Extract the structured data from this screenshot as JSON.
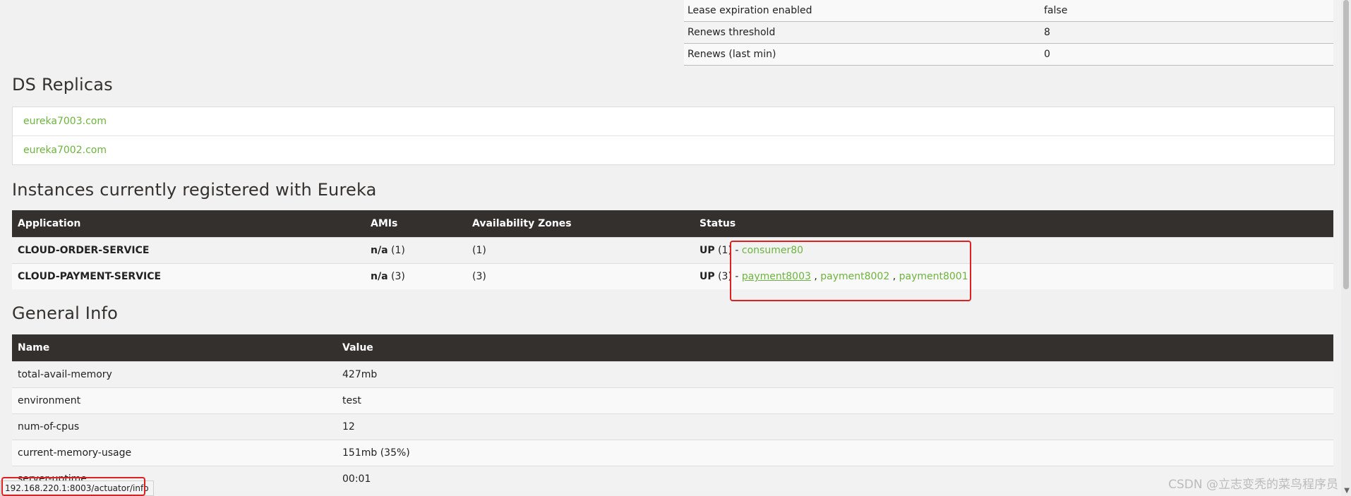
{
  "top_stats": [
    {
      "name": "Lease expiration enabled",
      "value": "false"
    },
    {
      "name": "Renews threshold",
      "value": "8"
    },
    {
      "name": "Renews (last min)",
      "value": "0"
    }
  ],
  "replicas": {
    "title": "DS Replicas",
    "items": [
      "eureka7003.com",
      "eureka7002.com"
    ]
  },
  "instances": {
    "title": "Instances currently registered with Eureka",
    "headers": [
      "Application",
      "AMIs",
      "Availability Zones",
      "Status"
    ],
    "rows": [
      {
        "app": "CLOUD-ORDER-SERVICE",
        "ami_bold": "n/a",
        "ami_count": "(1)",
        "zones": "(1)",
        "status_bold": "UP",
        "status_count": "(1) -",
        "links": [
          "consumer80"
        ]
      },
      {
        "app": "CLOUD-PAYMENT-SERVICE",
        "ami_bold": "n/a",
        "ami_count": "(3)",
        "zones": "(3)",
        "status_bold": "UP",
        "status_count": "(3) -",
        "links": [
          "payment8003",
          "payment8002",
          "payment8001"
        ]
      }
    ]
  },
  "general": {
    "title": "General Info",
    "headers": [
      "Name",
      "Value"
    ],
    "rows": [
      {
        "name": "total-avail-memory",
        "value": "427mb"
      },
      {
        "name": "environment",
        "value": "test"
      },
      {
        "name": "num-of-cpus",
        "value": "12"
      },
      {
        "name": "current-memory-usage",
        "value": "151mb (35%)"
      },
      {
        "name": "server-uptime",
        "value": "00:01"
      }
    ]
  },
  "statusbar": {
    "url": "192.168.220.1:8003/actuator/info"
  },
  "watermark": "CSDN @立志变秃的菜鸟程序员",
  "colors": {
    "header_bg": "#34302d",
    "link": "#6db33f",
    "annotation": "#e02020",
    "page_bg": "#f1f1f1"
  }
}
